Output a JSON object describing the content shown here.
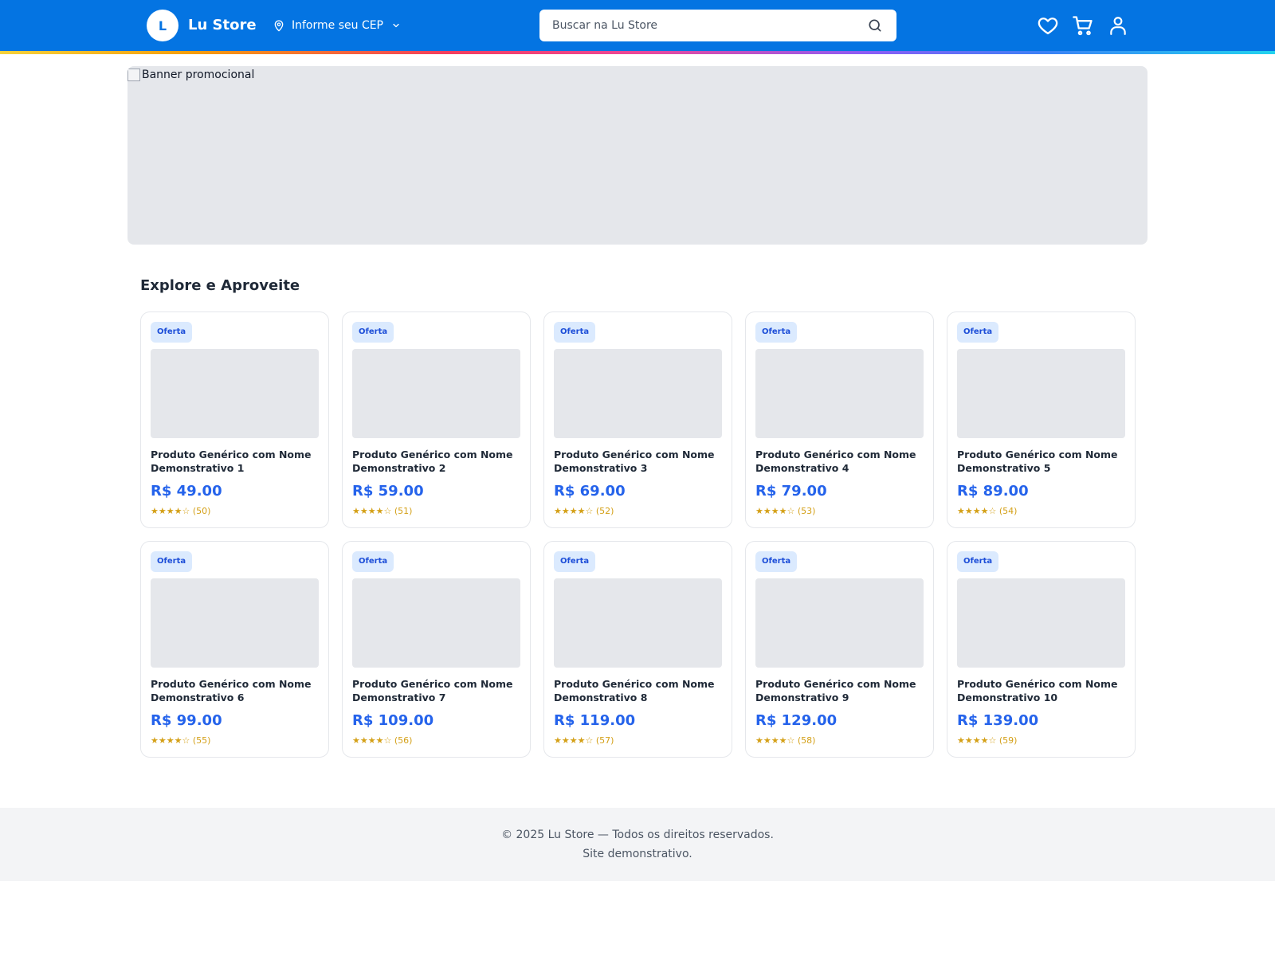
{
  "header": {
    "logo_letter": "L",
    "brand": "Lu Store",
    "cep_label": "Informe seu CEP",
    "search_placeholder": "Buscar na Lu Store",
    "icons": [
      "heart-icon",
      "cart-icon",
      "user-icon"
    ],
    "color": "#0474e2"
  },
  "banner": {
    "alt": "Banner promocional"
  },
  "section": {
    "title": "Explore e Aproveite"
  },
  "products": [
    {
      "badge": "Oferta",
      "name": "Produto Genérico com Nome Demonstrativo 1",
      "price": "R$ 49.00",
      "stars": "★★★★☆",
      "reviews": "(50)",
      "rating": 4
    },
    {
      "badge": "Oferta",
      "name": "Produto Genérico com Nome Demonstrativo 2",
      "price": "R$ 59.00",
      "stars": "★★★★☆",
      "reviews": "(51)",
      "rating": 4
    },
    {
      "badge": "Oferta",
      "name": "Produto Genérico com Nome Demonstrativo 3",
      "price": "R$ 69.00",
      "stars": "★★★★☆",
      "reviews": "(52)",
      "rating": 4
    },
    {
      "badge": "Oferta",
      "name": "Produto Genérico com Nome Demonstrativo 4",
      "price": "R$ 79.00",
      "stars": "★★★★☆",
      "reviews": "(53)",
      "rating": 4
    },
    {
      "badge": "Oferta",
      "name": "Produto Genérico com Nome Demonstrativo 5",
      "price": "R$ 89.00",
      "stars": "★★★★☆",
      "reviews": "(54)",
      "rating": 4
    },
    {
      "badge": "Oferta",
      "name": "Produto Genérico com Nome Demonstrativo 6",
      "price": "R$ 99.00",
      "stars": "★★★★☆",
      "reviews": "(55)",
      "rating": 4
    },
    {
      "badge": "Oferta",
      "name": "Produto Genérico com Nome Demonstrativo 7",
      "price": "R$ 109.00",
      "stars": "★★★★☆",
      "reviews": "(56)",
      "rating": 4
    },
    {
      "badge": "Oferta",
      "name": "Produto Genérico com Nome Demonstrativo 8",
      "price": "R$ 119.00",
      "stars": "★★★★☆",
      "reviews": "(57)",
      "rating": 4
    },
    {
      "badge": "Oferta",
      "name": "Produto Genérico com Nome Demonstrativo 9",
      "price": "R$ 129.00",
      "stars": "★★★★☆",
      "reviews": "(58)",
      "rating": 4
    },
    {
      "badge": "Oferta",
      "name": "Produto Genérico com Nome Demonstrativo 10",
      "price": "R$ 139.00",
      "stars": "★★★★☆",
      "reviews": "(59)",
      "rating": 4
    }
  ],
  "footer": {
    "line1": "© 2025 Lu Store — Todos os direitos reservados.",
    "line2": "Site demonstrativo."
  }
}
